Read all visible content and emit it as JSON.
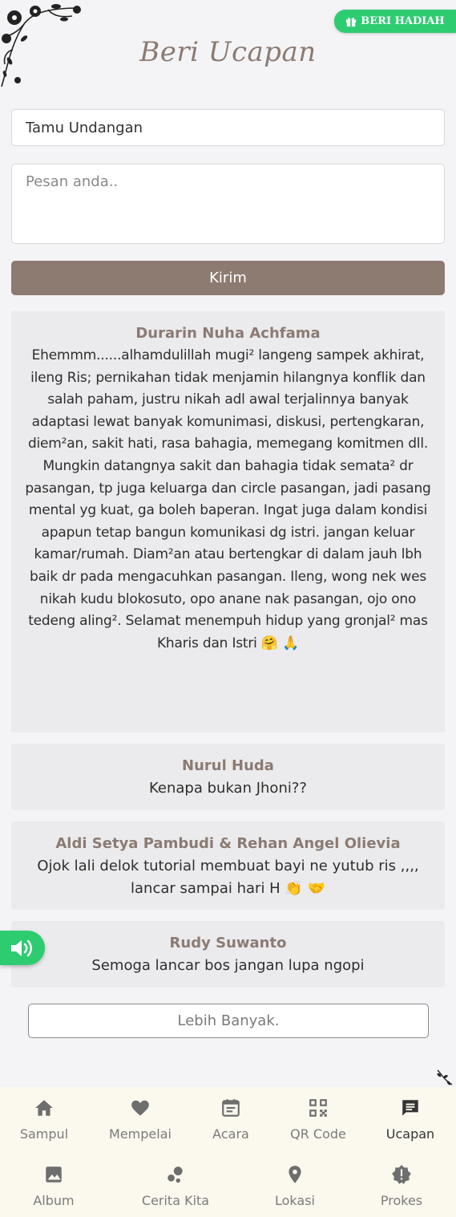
{
  "header": {
    "title": "Beri Ucapan",
    "gift_button": "BERI HADIAH"
  },
  "form": {
    "name_value": "Tamu Undangan",
    "message_placeholder": "Pesan anda..",
    "send_label": "Kirim"
  },
  "comments": [
    {
      "name": "Durarin Nuha Achfama",
      "message": "Ehemmm......alhamdulillah mugi² langeng sampek akhirat, ileng Ris; pernikahan tidak menjamin hilangnya konflik dan salah paham, justru nikah adl awal terjalinnya banyak adaptasi lewat banyak komunimasi, diskusi, pertengkaran, diem²an, sakit hati, rasa bahagia, memegang komitmen dll. Mungkin datangnya sakit dan bahagia tidak semata² dr pasangan, tp juga keluarga dan circle pasangan, jadi pasang mental yg kuat, ga boleh baperan. Ingat juga dalam kondisi apapun tetap bangun komunikasi dg istri. jangan keluar kamar/rumah. Diam²an atau bertengkar di dalam jauh lbh baik dr pada mengacuhkan pasangan. Ileng, wong nek wes nikah kudu blokosuto, opo anane nak pasangan, ojo ono tedeng aling². Selamat menempuh hidup yang gronjal² mas Kharis dan Istri 🤗 🙏"
    },
    {
      "name": "Nurul Huda",
      "message": "Kenapa bukan Jhoni??"
    },
    {
      "name": "Aldi Setya Pambudi & Rehan Angel Olievia",
      "message": "Ojok lali delok tutorial membuat bayi ne yutub ris ,,,, lancar sampai hari H 👏 🤝"
    },
    {
      "name": "Rudy Suwanto",
      "message": "Semoga lancar bos jangan lupa ngopi"
    }
  ],
  "load_more_label": "Lebih Banyak.",
  "nav": {
    "items": [
      {
        "label": "Sampul",
        "icon": "home-icon"
      },
      {
        "label": "Mempelai",
        "icon": "heart-icon"
      },
      {
        "label": "Acara",
        "icon": "calendar-icon"
      },
      {
        "label": "QR Code",
        "icon": "qr-code-icon"
      },
      {
        "label": "Ucapan",
        "icon": "chat-icon"
      },
      {
        "label": "Album",
        "icon": "image-icon"
      },
      {
        "label": "Cerita Kita",
        "icon": "bubbles-icon"
      },
      {
        "label": "Lokasi",
        "icon": "location-pin-icon"
      },
      {
        "label": "Prokes",
        "icon": "badge-alert-icon"
      }
    ]
  },
  "colors": {
    "accent": "#8d7b72",
    "green": "#2ecc71",
    "nav_background": "#fbf8ee"
  }
}
